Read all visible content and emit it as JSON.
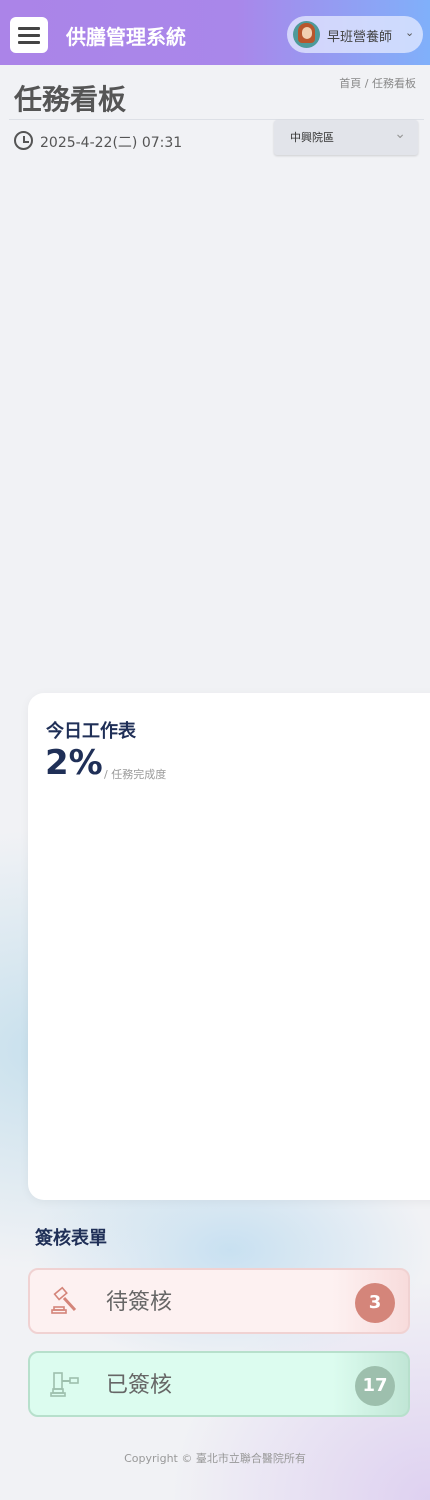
{
  "header": {
    "title": "供膳管理系統",
    "user": "早班營養師"
  },
  "page": {
    "title": "任務看板",
    "breadcrumb": "首頁 / 任務看板",
    "datetime": "2025-4-22(二) 07:31",
    "campus": "中興院區"
  },
  "worksheet": {
    "title": "今日工作表",
    "progress_percent": "2%",
    "progress_label": "/ 任務完成度"
  },
  "signoff": {
    "title": "簽核表單",
    "items": [
      {
        "label": "待簽核",
        "count": "3",
        "color": "#d4857a",
        "icon": "gavel-icon"
      },
      {
        "label": "已簽核",
        "count": "17",
        "color": "#9dbfad",
        "icon": "gavel-icon"
      }
    ]
  },
  "footer": {
    "copyright": "Copyright © 臺北市立聯合醫院所有"
  },
  "colors": {
    "header_start": "#ab84e8",
    "header_end": "#80b0fa",
    "navy": "#1f2f57"
  }
}
